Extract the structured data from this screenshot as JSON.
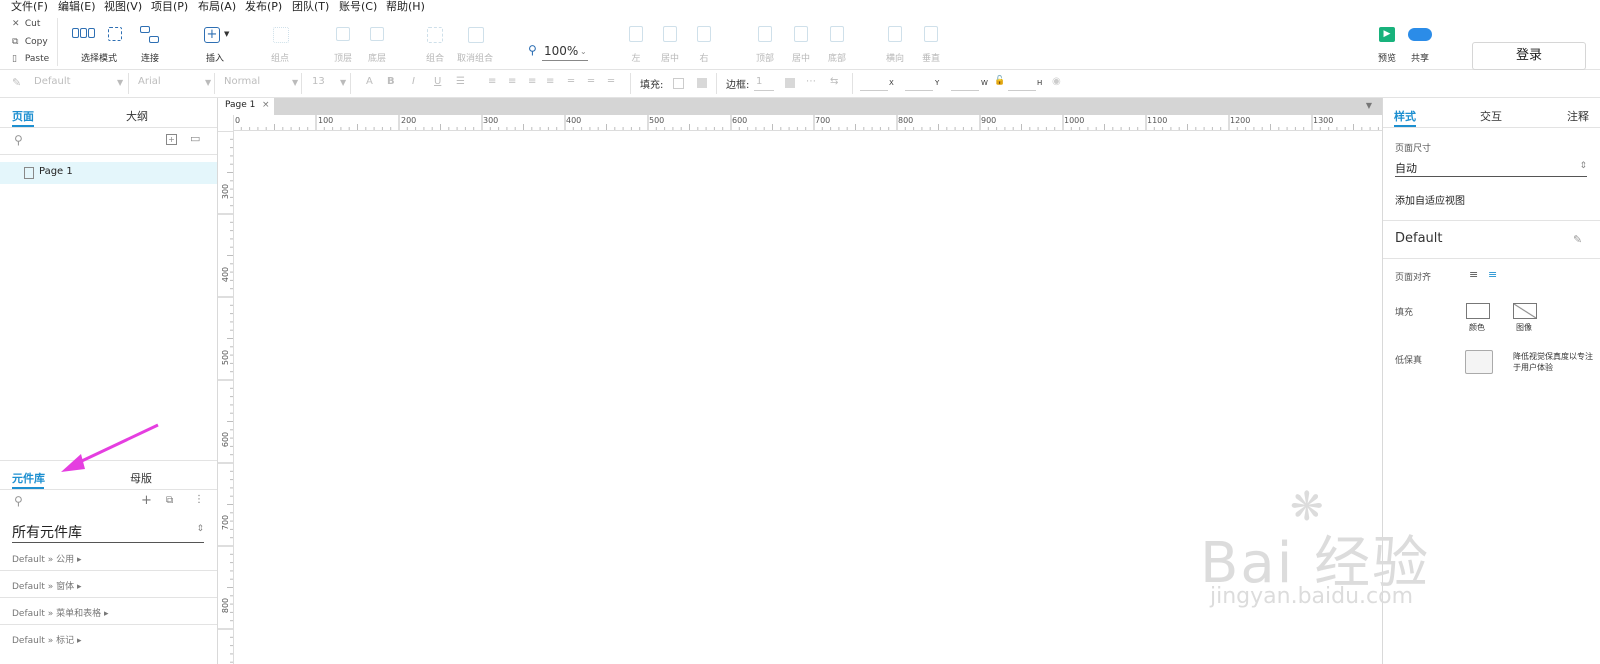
{
  "menu": [
    "文件(F)",
    "编辑(E)",
    "视图(V)",
    "项目(P)",
    "布局(A)",
    "发布(P)",
    "团队(T)",
    "账号(C)",
    "帮助(H)"
  ],
  "clipboard": {
    "cut": "Cut",
    "copy": "Copy",
    "paste": "Paste"
  },
  "toolbar": {
    "select_mode": "选择模式",
    "connect": "连接",
    "insert": "插入",
    "point": "组点",
    "top_layer": "顶层",
    "bottom_layer": "底层",
    "group": "组合",
    "ungroup": "取消组合",
    "zoom": "100%",
    "align_left": "左",
    "align_center": "居中",
    "align_right": "右",
    "align_top": "顶部",
    "align_middle": "居中",
    "align_bottom": "底部",
    "distribute_h": "横向",
    "distribute_v": "垂直",
    "preview": "预览",
    "share": "共享",
    "login": "登录"
  },
  "stylebar": {
    "style": "Default",
    "font": "Arial",
    "weight": "Normal",
    "size": "13",
    "fill_label": "填充:",
    "border_label": "边框:",
    "border_value": "1",
    "x": "X",
    "y": "Y",
    "w": "W",
    "h": "H"
  },
  "left_panel": {
    "tabs": [
      "页面",
      "大纲"
    ],
    "pages": [
      "Page 1"
    ],
    "lib_tabs": [
      "元件库",
      "母版"
    ],
    "lib_select": "所有元件库",
    "lib_items": [
      "Default » 公用 ▸",
      "Default » 窗体 ▸",
      "Default » 菜单和表格 ▸",
      "Default » 标记 ▸"
    ]
  },
  "canvas": {
    "page_tab": "Page 1",
    "h_ruler": [
      "0",
      "100",
      "200",
      "300",
      "400",
      "500",
      "600",
      "700",
      "800",
      "900",
      "1000",
      "1100",
      "1200",
      "1300"
    ],
    "v_ruler": [
      "300",
      "400",
      "500",
      "600",
      "700",
      "800"
    ]
  },
  "right_panel": {
    "tabs": [
      "样式",
      "交互",
      "注释"
    ],
    "page_size_label": "页面尺寸",
    "page_size_value": "自动",
    "add_adaptive": "添加自适应视图",
    "style_name": "Default",
    "page_align_label": "页面对齐",
    "fill_label": "填充",
    "fill_color": "颜色",
    "fill_image": "图像",
    "low_fidelity_label": "低保真",
    "low_fidelity_desc": "降低视觉保真度以专注于用户体验"
  },
  "watermark": {
    "brand": "Bai 经验",
    "url": "jingyan.baidu.com"
  },
  "colors": {
    "accent": "#1d8fd0",
    "arrow": "#e53ee0",
    "preview": "#18b27c",
    "share": "#2b8ce8"
  }
}
